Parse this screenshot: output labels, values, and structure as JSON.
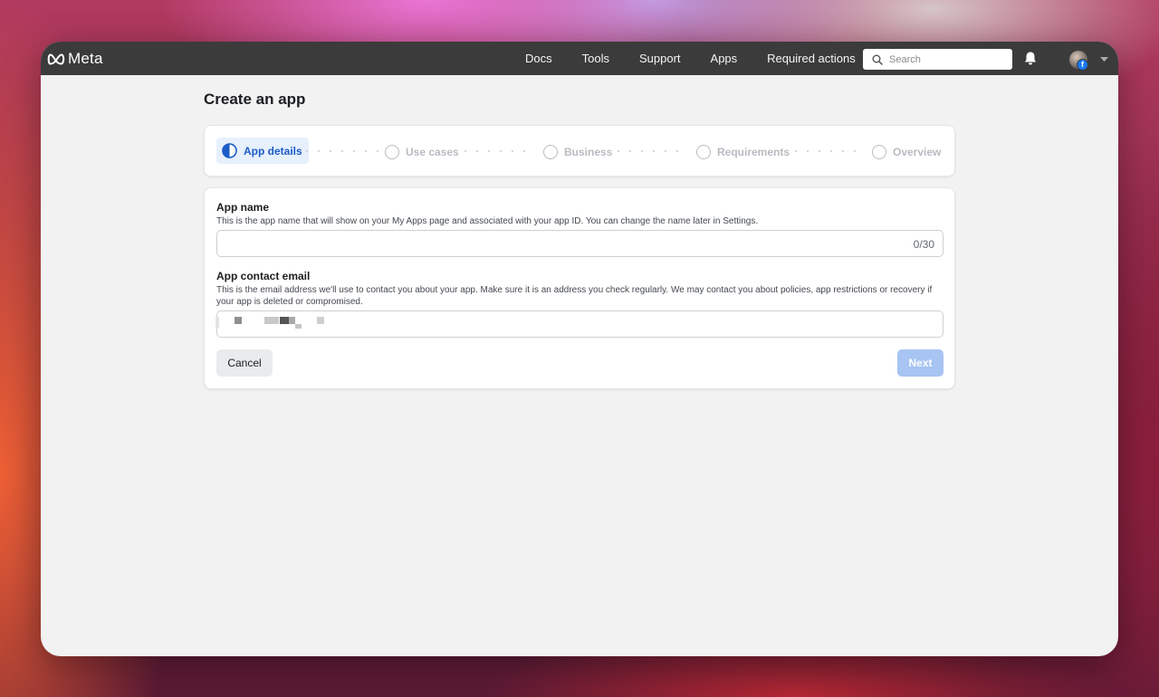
{
  "brand": {
    "logo_text": "Meta"
  },
  "nav": {
    "items": [
      {
        "label": "Docs"
      },
      {
        "label": "Tools"
      },
      {
        "label": "Support"
      },
      {
        "label": "Apps"
      },
      {
        "label": "Required actions"
      }
    ]
  },
  "search": {
    "placeholder": "Search"
  },
  "avatar": {
    "badge": "f"
  },
  "page": {
    "title": "Create an app"
  },
  "stepper": {
    "steps": [
      {
        "label": "App details",
        "state": "active"
      },
      {
        "label": "Use cases",
        "state": "pending"
      },
      {
        "label": "Business",
        "state": "pending"
      },
      {
        "label": "Requirements",
        "state": "pending"
      },
      {
        "label": "Overview",
        "state": "pending"
      }
    ]
  },
  "form": {
    "app_name": {
      "label": "App name",
      "help": "This is the app name that will show on your My Apps page and associated with your app ID. You can change the name later in Settings.",
      "value": "",
      "counter": "0/30"
    },
    "app_email": {
      "label": "App contact email",
      "help": "This is the email address we'll use to contact you about your app. Make sure it is an address you check regularly. We may contact you about policies, app restrictions or recovery if your app is deleted or compromised."
    },
    "cancel_label": "Cancel",
    "next_label": "Next"
  },
  "colors": {
    "topbar": "#3b3b3b",
    "accent": "#1b5bc7",
    "active_step_bg": "#e7f0fd",
    "next_disabled": "#a7c4f2"
  }
}
